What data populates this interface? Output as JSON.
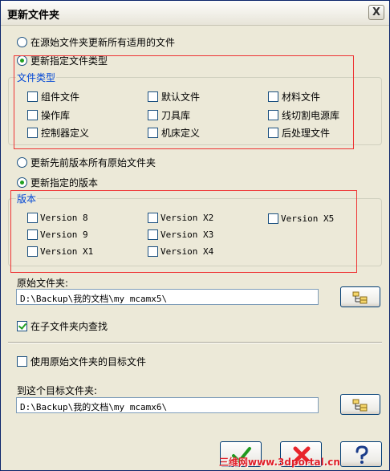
{
  "window": {
    "title": "更新文件夹",
    "close_label": "X"
  },
  "options": {
    "update_all_applicable": "在源始文件夹更新所有适用的文件",
    "update_specified_types": "更新指定文件类型",
    "update_previous_all": "更新先前版本所有原始文件夹",
    "update_specified_version": "更新指定的版本"
  },
  "file_types": {
    "group_label": "文件类型",
    "items": [
      {
        "label": "组件文件",
        "checked": false
      },
      {
        "label": "默认文件",
        "checked": false
      },
      {
        "label": "材料文件",
        "checked": false
      },
      {
        "label": "操作库",
        "checked": false
      },
      {
        "label": "刀具库",
        "checked": false
      },
      {
        "label": "线切割电源库",
        "checked": false
      },
      {
        "label": "控制器定义",
        "checked": false
      },
      {
        "label": "机床定义",
        "checked": false
      },
      {
        "label": "后处理文件",
        "checked": false
      }
    ]
  },
  "versions": {
    "group_label": "版本",
    "items": [
      {
        "label": "Version 8",
        "checked": false
      },
      {
        "label": "Version X2",
        "checked": false
      },
      {
        "label": "Version X5",
        "checked": false
      },
      {
        "label": "Version 9",
        "checked": false
      },
      {
        "label": "Version X3",
        "checked": false
      },
      {
        "label": "Version X1",
        "checked": false
      },
      {
        "label": "Version X4",
        "checked": false
      }
    ]
  },
  "source_folder": {
    "label": "原始文件夹:",
    "value": "D:\\Backup\\我的文档\\my mcamx5\\"
  },
  "search_subfolders": {
    "label": "在子文件夹内查找",
    "checked": true
  },
  "use_source_target": {
    "label": "使用原始文件夹的目标文件",
    "checked": false
  },
  "target_folder": {
    "label": "到这个目标文件夹:",
    "value": "D:\\Backup\\我的文档\\my mcamx6\\"
  },
  "watermark": "三维网www.3dportal.cn",
  "colors": {
    "accent": "#21a121",
    "group_label": "#0046d5",
    "highlight_box": "#e33333",
    "cancel": "#e8242a"
  }
}
